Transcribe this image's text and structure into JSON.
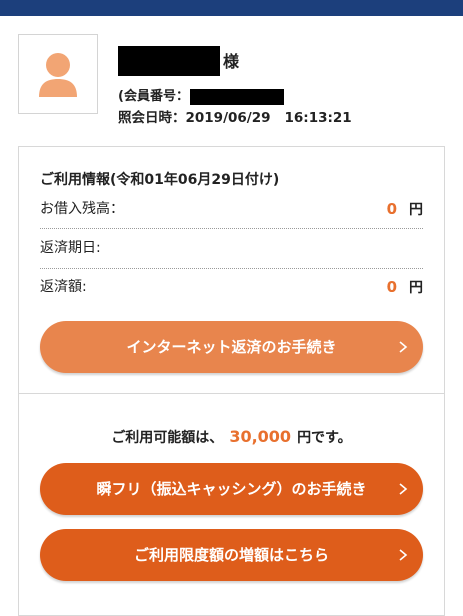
{
  "colors": {
    "header_bar": "#1c3f7c",
    "accent_orange": "#e8702e",
    "button_light": "#e8854d",
    "button_dark": "#de5d1b",
    "avatar_orange": "#f2a574"
  },
  "profile": {
    "avatar_icon": "person-icon",
    "honorific": "様",
    "member_number_label": "(会員番号：",
    "inquiry_label": "照会日時：",
    "inquiry_date": "2019/06/29",
    "inquiry_time": "16:13:21"
  },
  "usage": {
    "title": "ご利用情報(令和01年06月29日付け)",
    "rows": [
      {
        "label": "お借入残高：",
        "value": "0",
        "unit": "円"
      },
      {
        "label": "返済期日:",
        "value": "",
        "unit": ""
      },
      {
        "label": "返済額:",
        "value": "0",
        "unit": "円"
      }
    ],
    "repay_button": "インターネット返済のお手続き"
  },
  "available": {
    "prefix": "ご利用可能額は、",
    "amount": "30,000",
    "suffix": "円です。"
  },
  "buttons": {
    "instant_transfer": "瞬フリ（振込キャッシング）のお手続き",
    "limit_increase": "ご利用限度額の増額はこちら"
  }
}
